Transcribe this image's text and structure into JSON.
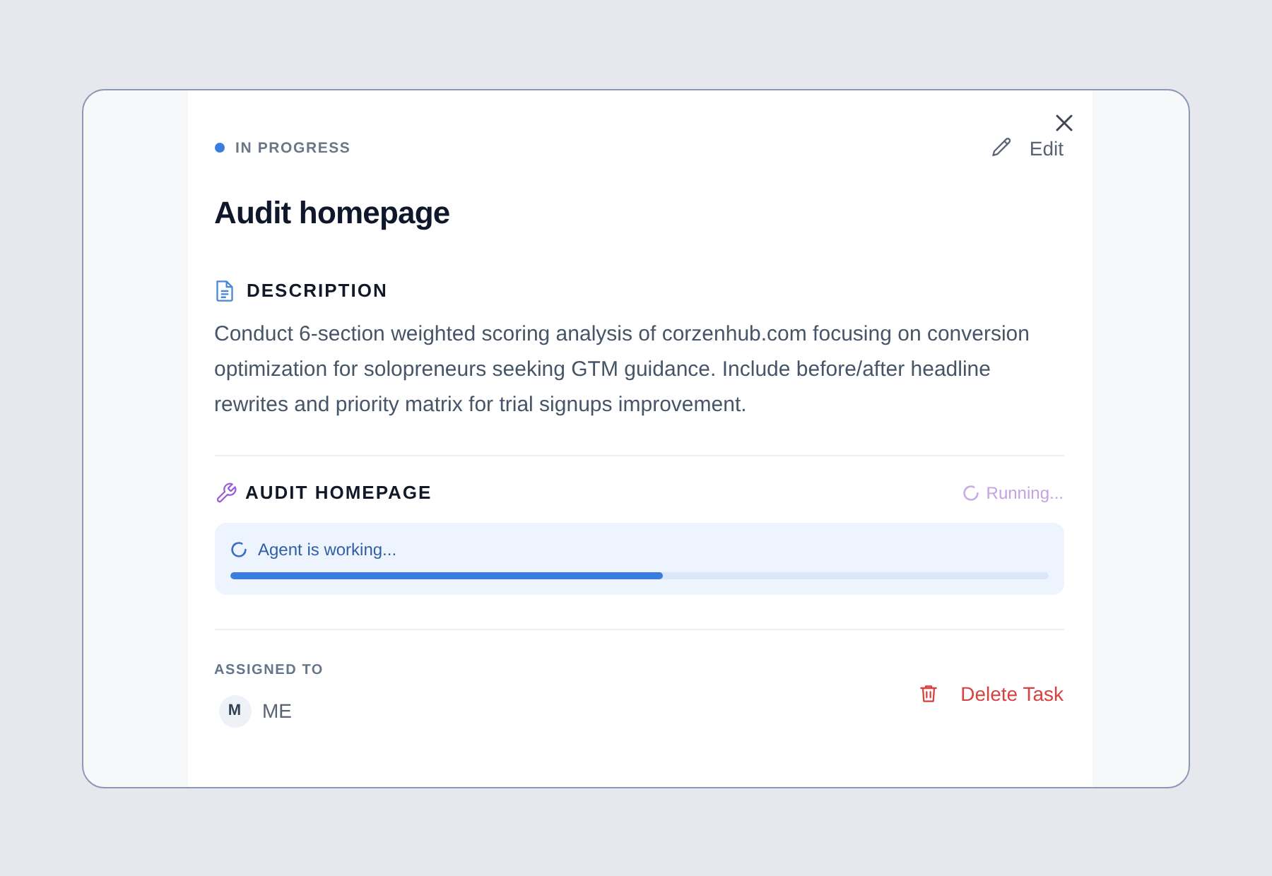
{
  "status": {
    "kind": "in_progress",
    "label": "IN PROGRESS"
  },
  "edit_button": {
    "label": "Edit"
  },
  "title": "Audit homepage",
  "description": {
    "heading": "DESCRIPTION",
    "text": "Conduct 6-section weighted scoring analysis of corzenhub.com focusing on conversion optimization for solopreneurs seeking GTM guidance. Include before/after headline rewrites and priority matrix for trial signups improvement."
  },
  "tool": {
    "heading": "AUDIT HOMEPAGE",
    "status": "Running...",
    "progress": {
      "label": "Agent is working...",
      "level": 0.53
    }
  },
  "assignee": {
    "heading": "ASSIGNED TO",
    "initial": "M",
    "name": "ME"
  },
  "delete_button": {
    "label": "Delete Task"
  }
}
